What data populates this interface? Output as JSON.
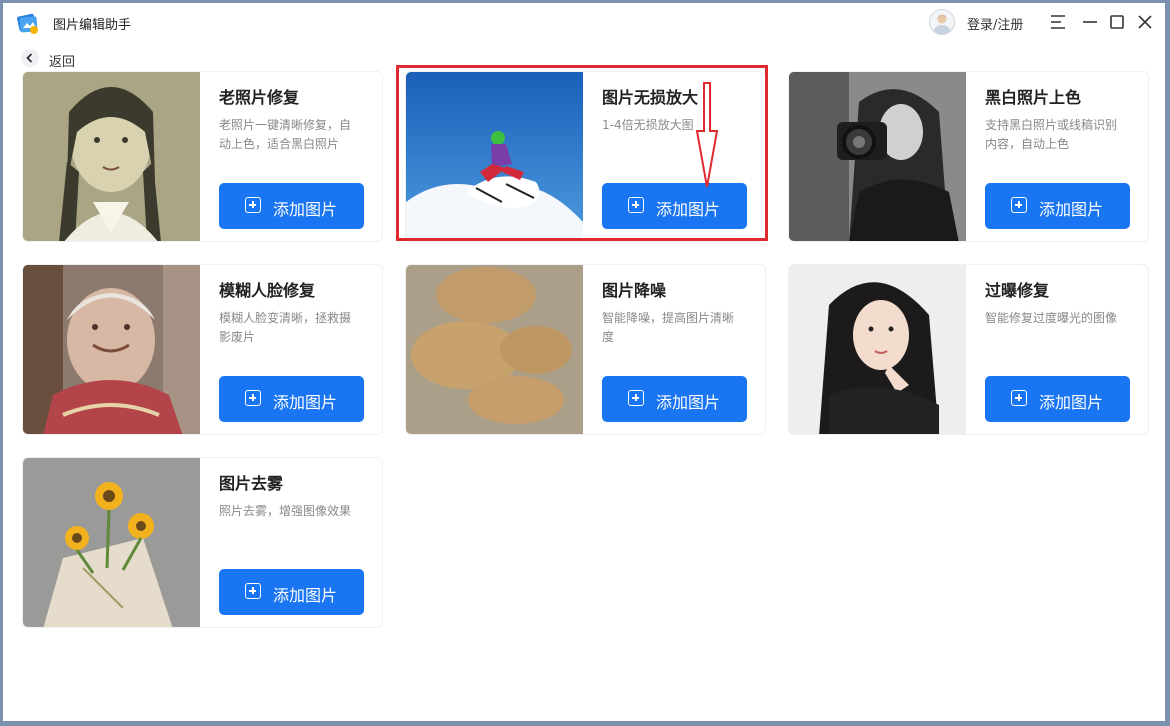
{
  "app": {
    "title": "图片编辑助手",
    "icon": "app-logo-icon"
  },
  "header": {
    "login_label": "登录/注册",
    "avatar_icon": "user-avatar-icon"
  },
  "window_controls": [
    "menu-icon",
    "minimize-icon",
    "maximize-icon",
    "close-icon"
  ],
  "nav": {
    "back_label": "返回"
  },
  "accent_color": "#1a75f2",
  "annotation_color": "#e0282f",
  "cards": [
    {
      "title": "老照片修复",
      "desc": "老照片一键清晰修复，自动上色，适合黑白照片",
      "button": "添加图片",
      "thumb": "old-photo-girl"
    },
    {
      "title": "图片无损放大",
      "desc": "1-4倍无损放大图",
      "button": "添加图片",
      "thumb": "skier"
    },
    {
      "title": "黑白照片上色",
      "desc": "支持黑白照片或线稿识别内容，自动上色",
      "button": "添加图片",
      "thumb": "photographer-bw"
    },
    {
      "title": "模糊人脸修复",
      "desc": "模糊人脸变清晰，拯救摄影废片",
      "button": "添加图片",
      "thumb": "old-woman"
    },
    {
      "title": "图片降噪",
      "desc": "智能降噪，提高图片清晰度",
      "button": "添加图片",
      "thumb": "noisy-bread"
    },
    {
      "title": "过曝修复",
      "desc": "智能修复过度曝光的图像",
      "button": "添加图片",
      "thumb": "woman-portrait"
    },
    {
      "title": "图片去雾",
      "desc": "照片去雾，增强图像效果",
      "button": "添加图片",
      "thumb": "sunflower-bouquet"
    }
  ]
}
